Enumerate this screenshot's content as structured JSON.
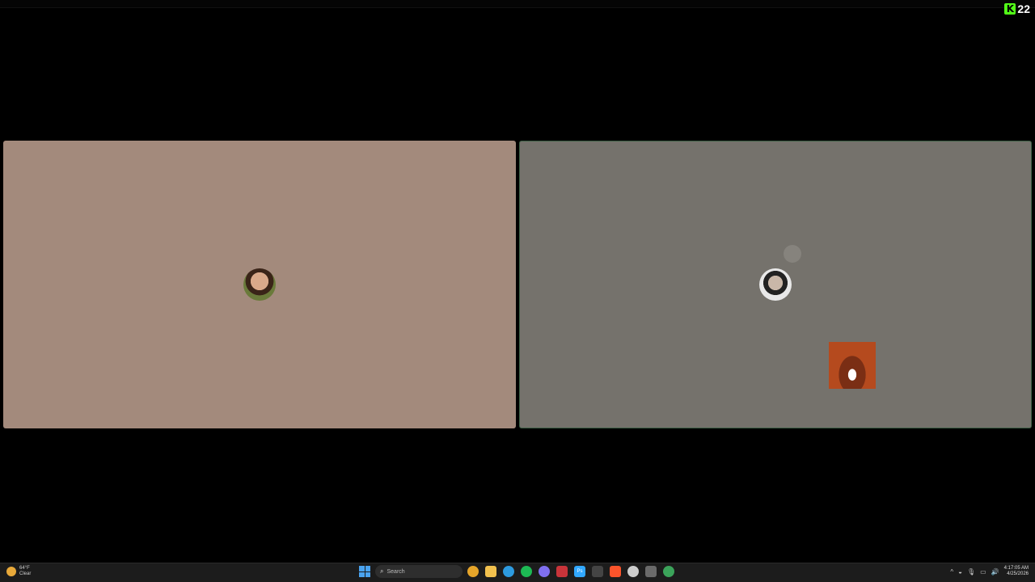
{
  "overlay": {
    "viewer_count": "22",
    "brand_glyph": "K"
  },
  "tiles": [
    {
      "name": "participant-left",
      "background": "#a38a7c"
    },
    {
      "name": "participant-right",
      "background": "#75726c"
    }
  ],
  "taskbar": {
    "weather": {
      "temp": "64°F",
      "condition": "Clear"
    },
    "search": {
      "placeholder": "Search"
    },
    "apps": [
      {
        "icon": "chrome-icon",
        "color": "#e6a52a"
      },
      {
        "icon": "file-explorer-icon",
        "color": "#f2c14e"
      },
      {
        "icon": "edge-icon",
        "color": "#2d9be0"
      },
      {
        "icon": "spotify-icon",
        "color": "#1db954"
      },
      {
        "icon": "discord-icon",
        "color": "#7f6ff0"
      },
      {
        "icon": "obs-icon",
        "color": "#c9343a"
      },
      {
        "icon": "photoshop-icon",
        "color": "#31a8ff",
        "label": "Ps"
      },
      {
        "icon": "terminal-icon",
        "color": "#444444"
      },
      {
        "icon": "brave-icon",
        "color": "#fb542b"
      },
      {
        "icon": "app-circle-icon",
        "color": "#cccccc"
      },
      {
        "icon": "steam-icon",
        "color": "#6a6a6a"
      },
      {
        "icon": "browser-alt-icon",
        "color": "#3ba35a"
      }
    ],
    "clock": {
      "time": "4:17:05 AM",
      "date": "4/25/2026"
    }
  }
}
